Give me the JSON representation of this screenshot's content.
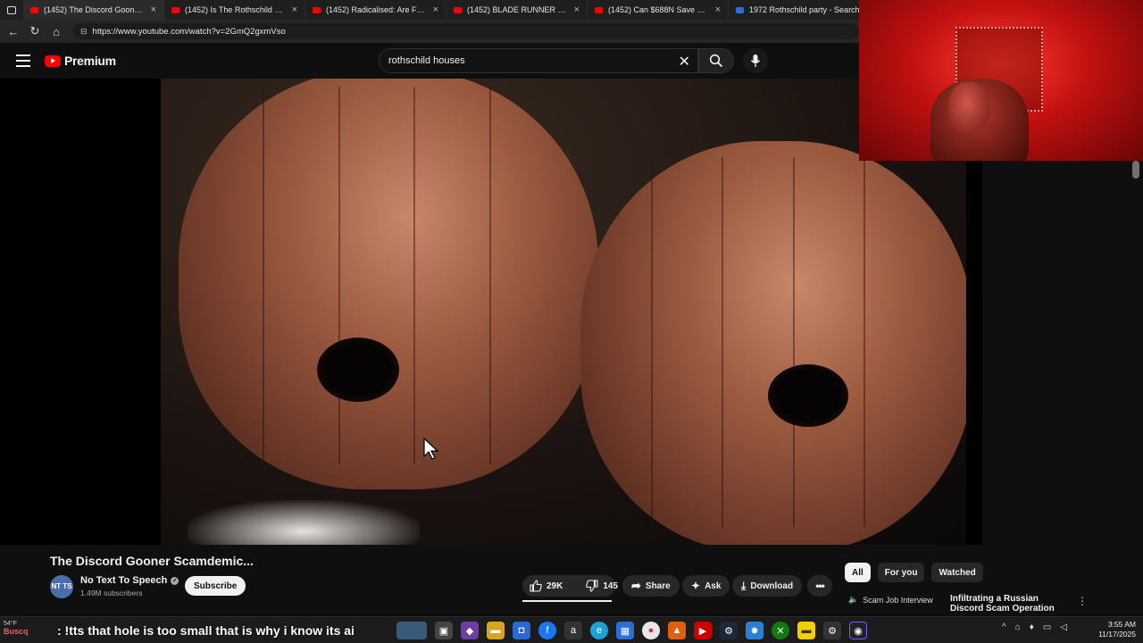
{
  "browser": {
    "tabs": [
      {
        "title": "(1452) The Discord Gooner S",
        "active": true
      },
      {
        "title": "(1452) Is The Rothschild Family Th",
        "active": false
      },
      {
        "title": "(1452) Radicalised: Are Femcels T",
        "active": false
      },
      {
        "title": "(1452) BLADE RUNNER 2049 Brea",
        "active": false
      },
      {
        "title": "(1452) Can $688N Save New York",
        "active": false
      },
      {
        "title": "1972 Rothschild party - Search",
        "active": false
      }
    ],
    "url": "https://www.youtube.com/watch?v=2GmQ2gxmVso"
  },
  "youtube": {
    "logo_label": "Premium",
    "search_query": "rothschild houses"
  },
  "video": {
    "title": "The Discord Gooner Scamdemic...",
    "channel_avatar_text": "NT TS",
    "channel_name": "No Text To Speech",
    "subscribers": "1.49M subscribers",
    "subscribe_label": "Subscribe",
    "likes": "29K",
    "dislikes": "145",
    "share_label": "Share",
    "ask_label": "Ask",
    "download_label": "Download"
  },
  "recommend": {
    "chips": [
      "All",
      "For you",
      "Watched"
    ],
    "item1_label": "Scam Job Interview",
    "item2_title": "Infiltrating a Russian Discord Scam Operation"
  },
  "taskbar": {
    "weather": "54°F",
    "stream_label": "Buscq",
    "caption": ": !tts that hole is too small that is why i know its ai",
    "time": "3:55 AM",
    "date": "11/17/2025"
  },
  "colors": {
    "youtube_red": "#ff0000",
    "background": "#0f0f0f",
    "webcam_red": "#e01a12"
  }
}
